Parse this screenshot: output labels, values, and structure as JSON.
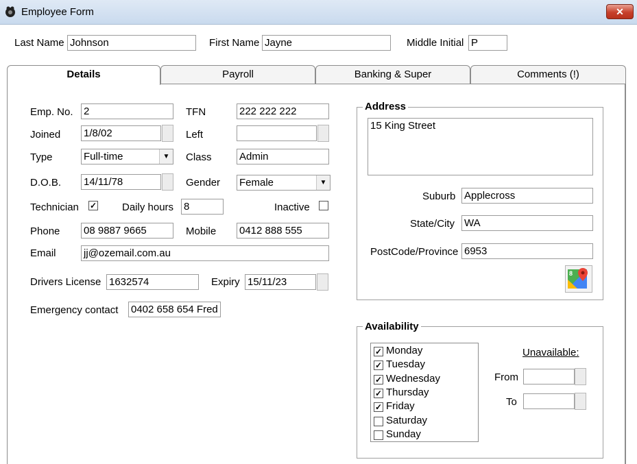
{
  "window": {
    "title": "Employee Form",
    "close_label": "✕"
  },
  "header": {
    "last_name_label": "Last Name",
    "last_name": "Johnson",
    "first_name_label": "First Name",
    "first_name": "Jayne",
    "middle_initial_label": "Middle Initial",
    "middle_initial": "P"
  },
  "tabs": [
    "Details",
    "Payroll",
    "Banking & Super",
    "Comments (!)"
  ],
  "details": {
    "emp_no_label": "Emp. No.",
    "emp_no": "2",
    "tfn_label": "TFN",
    "tfn": "222 222 222",
    "joined_label": "Joined",
    "joined": "1/8/02",
    "left_label": "Left",
    "left": "",
    "type_label": "Type",
    "type": "Full-time",
    "class_label": "Class",
    "class": "Admin",
    "dob_label": "D.O.B.",
    "dob": "14/11/78",
    "gender_label": "Gender",
    "gender": "Female",
    "technician_label": "Technician",
    "technician_checked": true,
    "technician_mark": "✓",
    "daily_hours_label": "Daily hours",
    "daily_hours": "8",
    "inactive_label": "Inactive",
    "inactive_checked": false,
    "phone_label": "Phone",
    "phone": "08 9887 9665",
    "mobile_label": "Mobile",
    "mobile": "0412 888 555",
    "email_label": "Email",
    "email": "jj@ozemail.com.au",
    "drivers_license_label": "Drivers License",
    "drivers_license": "1632574",
    "expiry_label": "Expiry",
    "expiry": "15/11/23",
    "emergency_label": "Emergency contact",
    "emergency": "0402 658 654 Fred"
  },
  "address": {
    "group_title": "Address",
    "street": "15 King Street",
    "suburb_label": "Suburb",
    "suburb": "Applecross",
    "state_label": "State/City",
    "state": "WA",
    "postcode_label": "PostCode/Province",
    "postcode": "6953",
    "maps_icon": "google-maps-icon"
  },
  "availability": {
    "group_title": "Availability",
    "check_mark": "✓",
    "days": [
      {
        "label": "Monday",
        "checked": true
      },
      {
        "label": "Tuesday",
        "checked": true
      },
      {
        "label": "Wednesday",
        "checked": true
      },
      {
        "label": "Thursday",
        "checked": true
      },
      {
        "label": "Friday",
        "checked": true
      },
      {
        "label": "Saturday",
        "checked": false
      },
      {
        "label": "Sunday",
        "checked": false
      }
    ],
    "unavailable_label": "Unavailable:",
    "from_label": "From",
    "from": "",
    "to_label": "To",
    "to": ""
  },
  "colors": {
    "close_button": "#c7412b",
    "titlebar": "#c9daee"
  }
}
